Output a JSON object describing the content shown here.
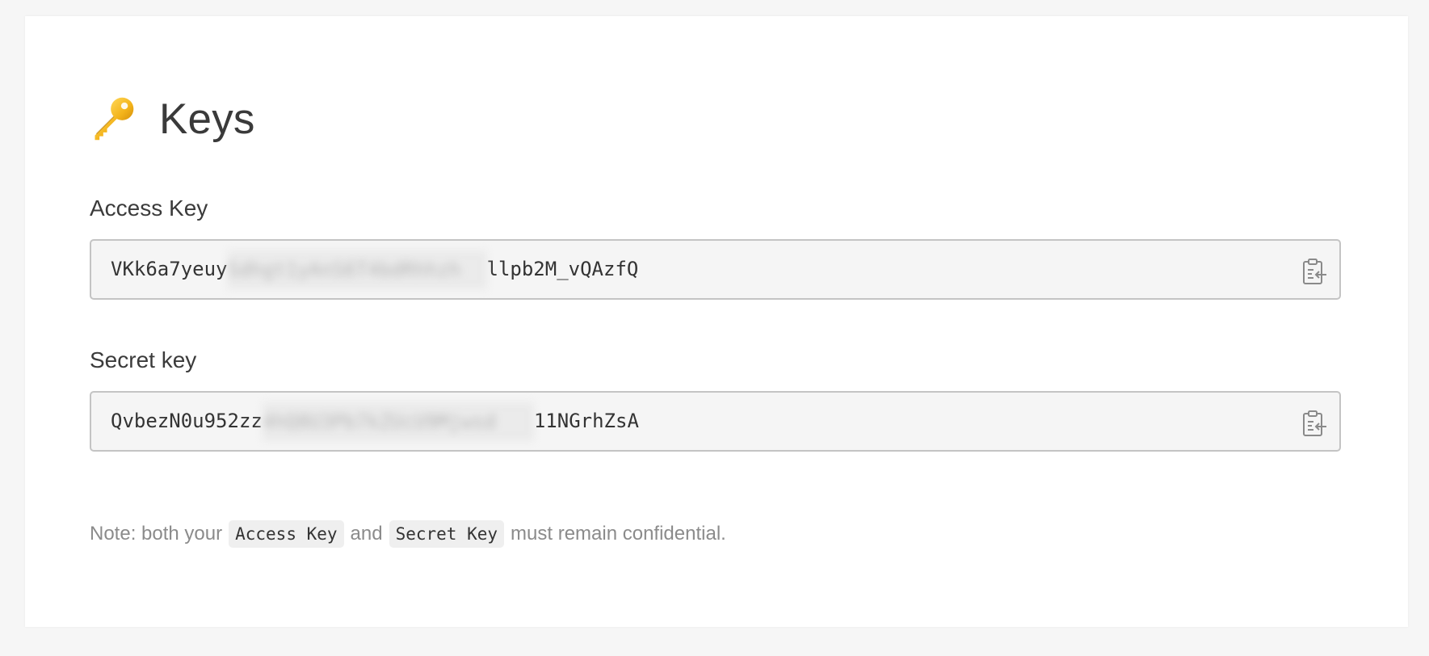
{
  "header": {
    "icon": "key-icon",
    "title": "Keys"
  },
  "access_key": {
    "label": "Access Key",
    "value_start": "VKk6a7yeuy",
    "value_redacted": "Sdhgt1yAnS6T4bdRhhzh",
    "value_end": "llpb2M_vQAzfQ",
    "copy_icon": "clipboard-icon"
  },
  "secret_key": {
    "label": "Secret key",
    "value_start": "QvbezN0u952zz",
    "value_redacted": "4hQ8U3Pb7kZUcU9Mjwsd",
    "value_end": "11NGrhZsA",
    "copy_icon": "clipboard-icon"
  },
  "note": {
    "prefix": "Note: both your",
    "code1": "Access Key",
    "middle": "and",
    "code2": "Secret Key",
    "suffix": "must remain confidential."
  },
  "colors": {
    "background": "#f6f6f6",
    "card": "#ffffff",
    "field_bg": "#f5f5f5",
    "field_border": "#c4c4c4",
    "text": "#3a3a3a",
    "muted": "#8b8b8b"
  }
}
